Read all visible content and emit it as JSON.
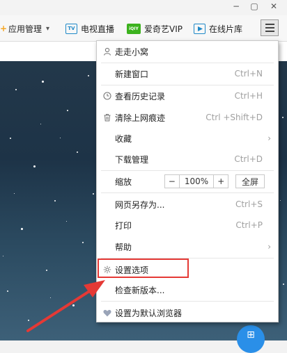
{
  "window": {
    "min_glyph": "−",
    "restore_glyph": "▢",
    "close_glyph": "✕"
  },
  "toolbar": {
    "items": [
      {
        "label": "应用管理",
        "icon": "apps-icon",
        "caret": "▾"
      },
      {
        "label": "电视直播",
        "icon": "tv-icon",
        "badge": "TV"
      },
      {
        "label": "爱奇艺VIP",
        "icon": "iqiyi-icon",
        "badge": "iQIY"
      },
      {
        "label": "在线片库",
        "icon": "film-library-icon"
      }
    ]
  },
  "menu": {
    "user": "走走小窝",
    "new_window": {
      "label": "新建窗口",
      "shortcut": "Ctrl+N"
    },
    "history": {
      "label": "查看历史记录",
      "shortcut": "Ctrl+H"
    },
    "clear_traces": {
      "label": "清除上网痕迹",
      "shortcut": "Ctrl +Shift+D"
    },
    "favorites": {
      "label": "收藏",
      "arrow": "›"
    },
    "downloads": {
      "label": "下载管理",
      "shortcut": "Ctrl+D"
    },
    "zoom": {
      "label": "缩放",
      "minus": "−",
      "value": "100%",
      "plus": "+",
      "fullscreen": "全屏"
    },
    "save_as": {
      "label": "网页另存为...",
      "shortcut": "Ctrl+S"
    },
    "print": {
      "label": "打印",
      "shortcut": "Ctrl+P"
    },
    "help": {
      "label": "帮助",
      "arrow": "›"
    },
    "settings": {
      "label": "设置选项"
    },
    "check_update": {
      "label": "检查新版本..."
    },
    "set_default": {
      "label": "设置为默认浏览器"
    }
  },
  "fab": {
    "glyph": "⊞"
  },
  "colors": {
    "annotation": "#e53935",
    "accent": "#2a8fe8"
  }
}
